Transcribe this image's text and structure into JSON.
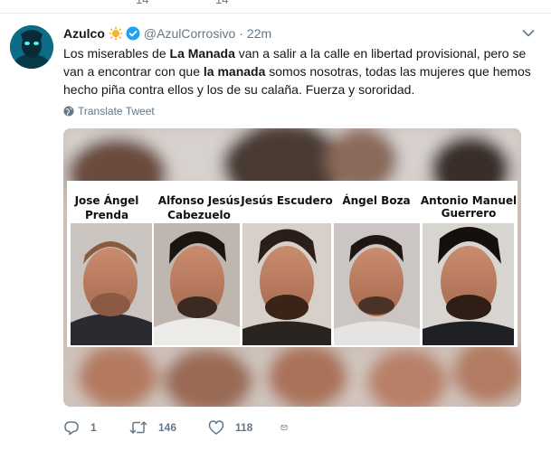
{
  "previous_tweet": {
    "counts": [
      "14",
      "14"
    ]
  },
  "tweet": {
    "display_name": "Azulco",
    "handle": "@AzulCorrosivo",
    "separator": "·",
    "time": "22m",
    "text_segments": [
      {
        "text": "Los miserables de ",
        "bold": false
      },
      {
        "text": "La Manada",
        "bold": true
      },
      {
        "text": " van a salir a la calle en libertad provisional, pero se van a encontrar con que ",
        "bold": false
      },
      {
        "text": "la manada",
        "bold": true
      },
      {
        "text": " somos nosotras, todas las mujeres que hemos hecho piña contra ellos y los de su calaña. Fuerza y sororidad.",
        "bold": false
      }
    ],
    "translate_label": "Translate Tweet",
    "media": {
      "people": [
        {
          "line1": "Jose Ángel",
          "line2": "Prenda"
        },
        {
          "line1": "Alfonso Jesús",
          "line2": "Cabezuelo"
        },
        {
          "line1": "Jesús Escudero",
          "line2": ""
        },
        {
          "line1": "Ángel Boza",
          "line2": ""
        },
        {
          "line1": "Antonio Manuel",
          "line2": "Guerrero"
        }
      ]
    },
    "actions": {
      "reply_count": "1",
      "retweet_count": "146",
      "like_count": "118"
    }
  },
  "colors": {
    "text": "#14171a",
    "secondary": "#657786",
    "verified": "#1da1f2",
    "divider": "#e6ecf0"
  }
}
